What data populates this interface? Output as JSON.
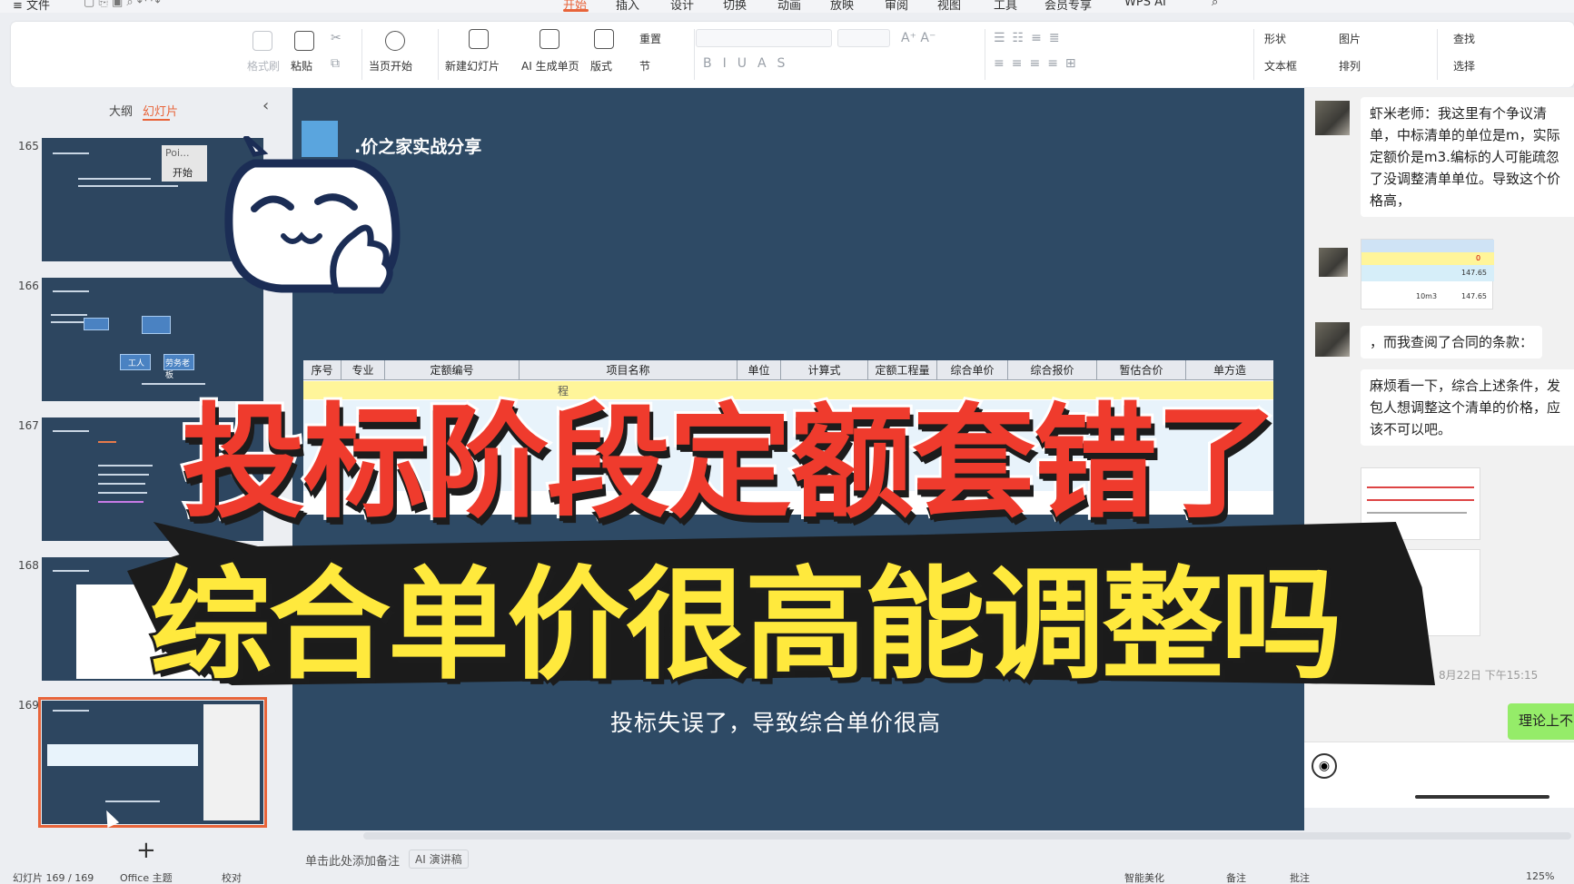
{
  "menubar": {
    "file": "≡ 文件",
    "tabs": [
      "开始",
      "插入",
      "设计",
      "切换",
      "动画",
      "放映",
      "审阅",
      "视图",
      "工具",
      "会员专享",
      "WPS AI"
    ]
  },
  "ribbon": {
    "format_painter": "格式刷",
    "paste": "粘贴",
    "play_current": "当页开始",
    "new_slide": "新建幻灯片",
    "ai_generate": "AI 生成单页",
    "layout": "版式",
    "reset": "重置",
    "section": "节",
    "shape": "形状",
    "picture": "图片",
    "textbox": "文本框",
    "arrange": "排列",
    "find": "查找",
    "select": "选择"
  },
  "left_panel": {
    "tab_outline": "大纲",
    "tab_slides": "幻灯片",
    "slides": [
      {
        "num": "165",
        "popup_input": "Poi...",
        "popup_button": "开始"
      },
      {
        "num": "166",
        "node1": "工人",
        "node2": "劳务老板"
      },
      {
        "num": "167"
      },
      {
        "num": "168"
      },
      {
        "num": "169"
      }
    ]
  },
  "slide": {
    "title": ".价之家实战分享",
    "caption": "投标失误了，导致综合单价很高",
    "table": {
      "headers": [
        "序号",
        "专业",
        "定额编号",
        "项目名称",
        "单位",
        "计算式",
        "定额工程量",
        "综合单价",
        "综合报价",
        "暂估合价",
        "单方造"
      ],
      "row_fragment": "程"
    }
  },
  "chat": {
    "msg1": "虾米老师：我这里有个争议清单，中标清单的单位是m，实际定额价是m3.编标的人可能疏忽了没调整清单单位。导致这个价格高，",
    "msg2": "，而我查阅了合同的条款：",
    "msg3": "麻烦看一下，综合上述条件，发包人想调整这个清单的价格，应该不可以吧。",
    "time": "8月22日 下午15:15",
    "green": "理论上不",
    "img_values": [
      "0",
      "147.65",
      "147.65",
      "10m3"
    ]
  },
  "overlay": {
    "line1": "投标阶段定额套错了",
    "line2": "综合单价很高能调整吗"
  },
  "bottom": {
    "notes": "单击此处添加备注",
    "ai_notes": "AI 演讲稿"
  },
  "statusbar": {
    "slide_count": "幻灯片 169 / 169",
    "theme": "Office 主题",
    "proof": "校对",
    "beautify": "智能美化",
    "notes": "备注",
    "comments": "批注",
    "zoom": "125%"
  },
  "colors": {
    "accent": "#e8643a",
    "slide_bg": "#2e4a65",
    "overlay_red": "#ef3b2d",
    "overlay_yellow": "#ffe93d"
  }
}
